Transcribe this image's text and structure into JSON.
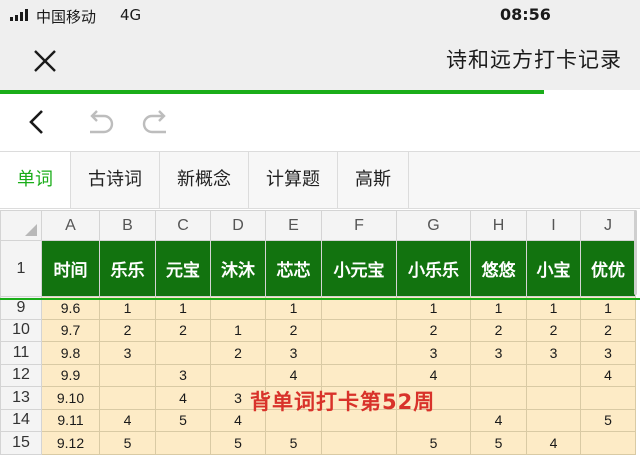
{
  "status": {
    "carrier": "中国移动",
    "network": "4G",
    "time": "08:56"
  },
  "header": {
    "title": "诗和远方打卡记录",
    "close_icon": "close-icon",
    "load_progress_fraction": 0.85
  },
  "toolbar": {
    "back_icon": "chevron-left-icon",
    "undo_icon": "undo-icon",
    "redo_icon": "redo-icon"
  },
  "tabs": [
    {
      "label": "单词",
      "active": true
    },
    {
      "label": "古诗词",
      "active": false
    },
    {
      "label": "新概念",
      "active": false
    },
    {
      "label": "计算题",
      "active": false
    },
    {
      "label": "高斯",
      "active": false
    }
  ],
  "sheet": {
    "columns": [
      "A",
      "B",
      "C",
      "D",
      "E",
      "F",
      "G",
      "H",
      "I",
      "J"
    ],
    "header_row_num": "1",
    "header": [
      "时间",
      "乐乐",
      "元宝",
      "沐沐",
      "芯芯",
      "小元宝",
      "小乐乐",
      "悠悠",
      "小宝",
      "优优"
    ],
    "rows": [
      {
        "num": "9",
        "cells": [
          "9.6",
          "1",
          "1",
          "",
          "1",
          "",
          "1",
          "1",
          "1",
          "1"
        ]
      },
      {
        "num": "10",
        "cells": [
          "9.7",
          "2",
          "2",
          "1",
          "2",
          "",
          "2",
          "2",
          "2",
          "2"
        ]
      },
      {
        "num": "11",
        "cells": [
          "9.8",
          "3",
          "",
          "2",
          "3",
          "",
          "3",
          "3",
          "3",
          "3"
        ]
      },
      {
        "num": "12",
        "cells": [
          "9.9",
          "",
          "3",
          "",
          "4",
          "",
          "4",
          "",
          "",
          "4"
        ]
      },
      {
        "num": "13",
        "cells": [
          "9.10",
          "",
          "4",
          "3",
          "",
          "",
          "",
          "",
          "",
          ""
        ]
      },
      {
        "num": "14",
        "cells": [
          "9.11",
          "4",
          "5",
          "4",
          "",
          "",
          "",
          "4",
          "",
          "5"
        ]
      },
      {
        "num": "15",
        "cells": [
          "9.12",
          "5",
          "",
          "5",
          "5",
          "",
          "5",
          "5",
          "4",
          ""
        ]
      }
    ],
    "overlay_text": "背单词打卡第52周",
    "accent_color": "#1aad19",
    "header_fill": "#12730f",
    "cell_fill": "#fdebc6"
  }
}
